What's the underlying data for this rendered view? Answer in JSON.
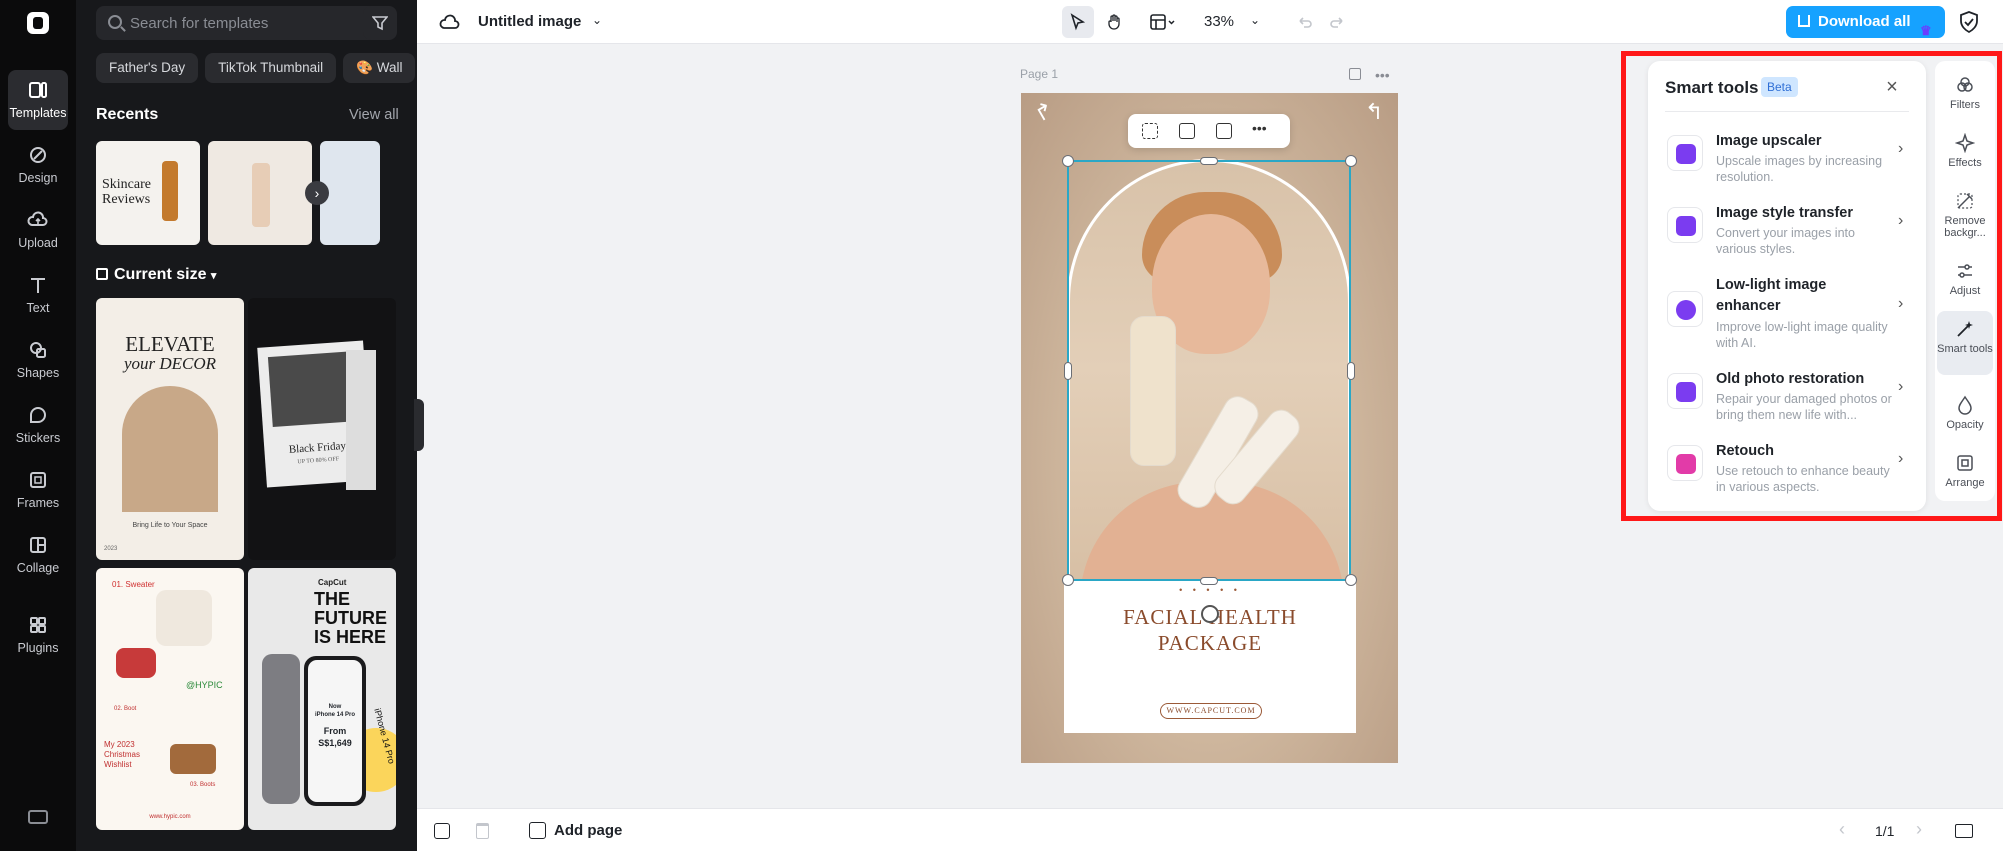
{
  "app": {
    "doc_title": "Untitled image",
    "zoom": "33%",
    "download_label": "Download all"
  },
  "rail": {
    "items": [
      {
        "label": "Templates",
        "icon": "templates-icon"
      },
      {
        "label": "Design",
        "icon": "design-icon"
      },
      {
        "label": "Upload",
        "icon": "upload-cloud-icon"
      },
      {
        "label": "Text",
        "icon": "text-icon"
      },
      {
        "label": "Shapes",
        "icon": "shapes-icon"
      },
      {
        "label": "Stickers",
        "icon": "stickers-icon"
      },
      {
        "label": "Frames",
        "icon": "frames-icon"
      },
      {
        "label": "Collage",
        "icon": "collage-icon"
      },
      {
        "label": "Plugins",
        "icon": "plugins-icon"
      }
    ]
  },
  "panel": {
    "search_placeholder": "Search for templates",
    "chips": [
      "Father's Day",
      "TikTok Thumbnail",
      "🎨 Wall"
    ],
    "recents_title": "Recents",
    "view_all": "View all",
    "current_size": "Current size",
    "recent_thumbs": [
      {
        "title": "Skincare Reviews"
      },
      {
        "title": ""
      },
      {
        "title": ""
      }
    ],
    "templates": [
      {
        "line1": "ELEVATE",
        "line2": "your DECOR",
        "caption": "Bring Life to Your Space",
        "year": "2023"
      },
      {
        "line1": "Black Friday",
        "line2": "UP TO 80% OFF"
      },
      {
        "line1": "01. Sweater",
        "line2": "@HYPIC",
        "line3": "My 2023 Christmas Wishlist",
        "line4": "02. Boot",
        "line5": "03. Boots",
        "url": "www.hypic.com"
      },
      {
        "line1": "THE",
        "line2": "FUTURE",
        "line3": "IS HERE",
        "brand": "CapCut",
        "line4": "Now",
        "line5": "iPhone 14 Pro",
        "line6": "From",
        "line7": "S$1,649",
        "side": "iPhone 14 Pro"
      }
    ]
  },
  "canvas": {
    "page_label": "Page 1",
    "headline_line1": "FACIAL HEALTH",
    "headline_line2": "PACKAGE",
    "dots": "• • • • •",
    "url": "WWW.CAPCUT.COM"
  },
  "bottom": {
    "add_page": "Add page",
    "pager": "1/1"
  },
  "smart_tools": {
    "title": "Smart tools",
    "badge": "Beta",
    "items": [
      {
        "name": "Image upscaler",
        "desc": "Upscale images by increasing resolution.",
        "icon": "upscale-4k-icon"
      },
      {
        "name": "Image style transfer",
        "desc": "Convert your images into various styles.",
        "icon": "style-transfer-icon"
      },
      {
        "name": "Low-light image enhancer",
        "desc": "Improve low-light image quality with AI.",
        "icon": "moon-enhance-icon"
      },
      {
        "name": "Old photo restoration",
        "desc": "Repair your damaged photos or bring them new life with...",
        "icon": "photo-restore-icon"
      },
      {
        "name": "Retouch",
        "desc": "Use retouch to enhance beauty in various aspects.",
        "icon": "retouch-icon"
      }
    ]
  },
  "right_rail": {
    "items": [
      {
        "label": "Filters"
      },
      {
        "label": "Effects"
      },
      {
        "label": "Remove backgr..."
      },
      {
        "label": "Adjust"
      },
      {
        "label": "Smart tools"
      },
      {
        "label": "Opacity"
      },
      {
        "label": "Arrange"
      }
    ]
  },
  "colors": {
    "accent": "#16a2ff",
    "smart_icon": "#7b3cf0",
    "highlight": "#ff1818",
    "selection": "#2aa7c6"
  }
}
